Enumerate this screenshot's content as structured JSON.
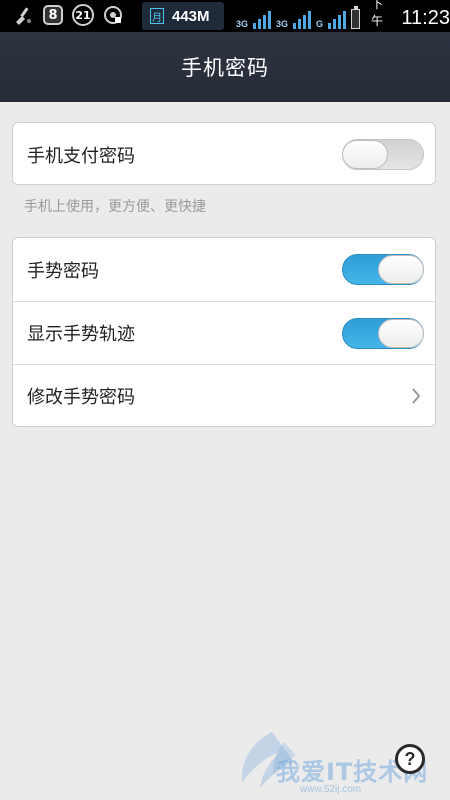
{
  "status_bar": {
    "notification_badge": "8",
    "calendar_badge": "21",
    "network_speed": "443M",
    "network_type_1": "3G",
    "network_type_2": "3G",
    "network_type_3": "G",
    "am_pm": "下午",
    "time": "11:23"
  },
  "header": {
    "title": "手机密码"
  },
  "payment_section": {
    "item_label": "手机支付密码",
    "toggle_on": false,
    "hint": "手机上使用，更方便、更快捷"
  },
  "gesture_section": {
    "items": [
      {
        "label": "手势密码",
        "toggle_on": true
      },
      {
        "label": "显示手势轨迹",
        "toggle_on": true
      },
      {
        "label": "修改手势密码"
      }
    ]
  },
  "footer": {
    "help_symbol": "?",
    "watermark_text": "我爱IT技术网",
    "watermark_url": "www.52ij.com"
  },
  "colors": {
    "accent": "#3aa9e0",
    "header_bg": "#2a313d",
    "page_bg": "#ebebeb"
  }
}
